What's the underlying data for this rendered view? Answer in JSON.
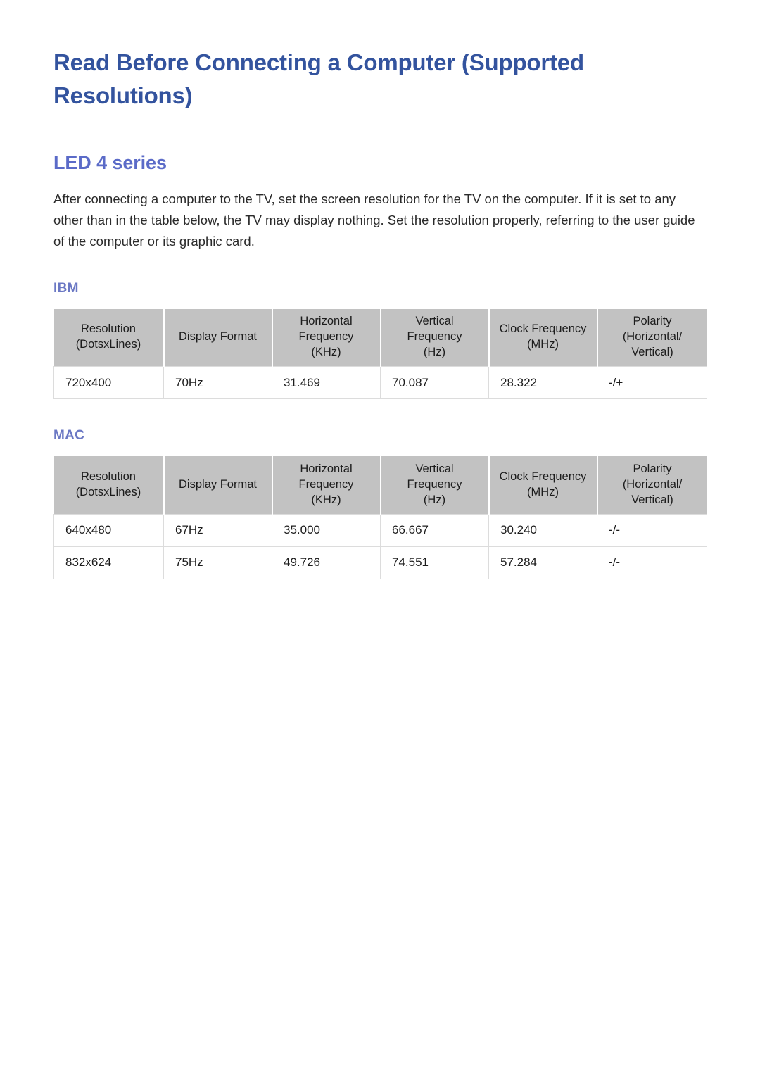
{
  "document": {
    "title": "Read Before Connecting a Computer (Supported Resolutions)",
    "section_heading": "LED 4 series",
    "intro_paragraph": "After connecting a computer to the TV, set the screen resolution for the TV on the computer. If it is set to any other than in the table below, the TV may display nothing. Set the resolution properly, referring to the user guide of the computer or its graphic card."
  },
  "colors": {
    "title": "#33539e",
    "section_heading": "#5b6bc8",
    "table_label": "#6b78c4",
    "table_header_bg": "#c2c2c2",
    "body_text": "#2b2b2b",
    "cell_border": "#dcdcdc"
  },
  "table_headers": {
    "resolution": {
      "line1": "Resolution",
      "line2": "(DotsxLines)"
    },
    "display_format": {
      "line1": "Display Format",
      "line2": ""
    },
    "horizontal_frequency": {
      "line1": "Horizontal",
      "line2": "Frequency",
      "line3": "(KHz)"
    },
    "vertical_frequency": {
      "line1": "Vertical",
      "line2": "Frequency",
      "line3": "(Hz)"
    },
    "clock_frequency": {
      "line1": "Clock Frequency",
      "line2": "(MHz)"
    },
    "polarity": {
      "line1": "Polarity",
      "line2": "(Horizontal/",
      "line3": "Vertical)"
    }
  },
  "tables": [
    {
      "label": "IBM",
      "rows": [
        {
          "resolution": "720x400",
          "display_format": "70Hz",
          "horizontal_frequency": "31.469",
          "vertical_frequency": "70.087",
          "clock_frequency": "28.322",
          "polarity": "-/+"
        }
      ]
    },
    {
      "label": "MAC",
      "rows": [
        {
          "resolution": "640x480",
          "display_format": "67Hz",
          "horizontal_frequency": "35.000",
          "vertical_frequency": "66.667",
          "clock_frequency": "30.240",
          "polarity": "-/-"
        },
        {
          "resolution": "832x624",
          "display_format": "75Hz",
          "horizontal_frequency": "49.726",
          "vertical_frequency": "74.551",
          "clock_frequency": "57.284",
          "polarity": "-/-"
        }
      ]
    }
  ]
}
